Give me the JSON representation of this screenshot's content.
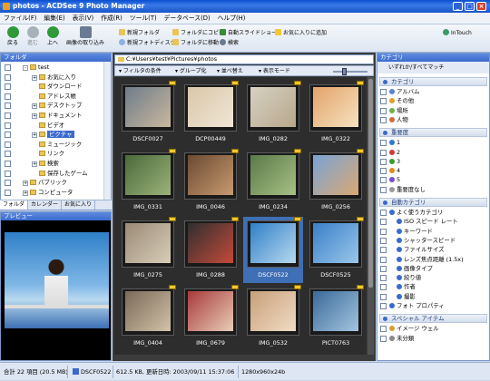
{
  "window": {
    "title": "photos - ACDSee 9 Photo Manager",
    "min": "_",
    "max": "□",
    "close": "×"
  },
  "menu": [
    "ファイル(F)",
    "編集(E)",
    "表示(V)",
    "作成(R)",
    "ツール(T)",
    "データベース(D)",
    "ヘルプ(H)"
  ],
  "toolbar": {
    "back": "戻る",
    "forward": "進む",
    "up": "上へ",
    "acquire": "画像の取り込み",
    "new_folder": "新規フォルダ",
    "new_photo_disc": "新規フォトディスク",
    "copy_to": "フォルダにコピー",
    "move_to": "フォルダに移動",
    "slideshow": "自動スライドショー",
    "search": "検索",
    "add_favorites": "お気に入りに追加",
    "intouch": "InTouch"
  },
  "folder_panel": {
    "title": "フォルダ",
    "items": [
      {
        "label": "test",
        "indent": 1,
        "expander": "-"
      },
      {
        "label": "お気に入り",
        "indent": 2,
        "expander": "+"
      },
      {
        "label": "ダウンロード",
        "indent": 2,
        "expander": ""
      },
      {
        "label": "アドレス帳",
        "indent": 2,
        "expander": ""
      },
      {
        "label": "デスクトップ",
        "indent": 2,
        "expander": "+"
      },
      {
        "label": "ドキュメント",
        "indent": 2,
        "expander": "+"
      },
      {
        "label": "ビデオ",
        "indent": 2,
        "expander": ""
      },
      {
        "label": "ピクチャ",
        "indent": 2,
        "expander": "+",
        "selected": true
      },
      {
        "label": "ミュージック",
        "indent": 2,
        "expander": ""
      },
      {
        "label": "リンク",
        "indent": 2,
        "expander": ""
      },
      {
        "label": "検索",
        "indent": 2,
        "expander": "+"
      },
      {
        "label": "保存したゲーム",
        "indent": 2,
        "expander": ""
      },
      {
        "label": "パブリック",
        "indent": 1,
        "expander": "+"
      },
      {
        "label": "コンピュータ",
        "indent": 1,
        "expander": "+"
      }
    ],
    "tabs": [
      "フォルダ",
      "カレンダー",
      "お気に入り"
    ]
  },
  "preview": {
    "title": "プレビュー"
  },
  "address": "C:¥Users¥test¥Pictures¥photos",
  "filterbar": {
    "filter": "フィルタの条件",
    "group": "グループ化",
    "sort": "並べ替え",
    "view": "表示モード"
  },
  "thumbnails": [
    {
      "name": "DSCF0027",
      "c1": "#6e7c8a",
      "c2": "#c9b89e"
    },
    {
      "name": "DCP00449",
      "c1": "#d9c7a8",
      "c2": "#f0e6d6"
    },
    {
      "name": "IMG_0282",
      "c1": "#d6d1c4",
      "c2": "#b8a78a"
    },
    {
      "name": "IMG_0322",
      "c1": "#e3a36a",
      "c2": "#f6e2c0"
    },
    {
      "name": "IMG_0331",
      "c1": "#4a6a3a",
      "c2": "#9cb27a"
    },
    {
      "name": "IMG_0046",
      "c1": "#6b4a32",
      "c2": "#c79a70"
    },
    {
      "name": "IMG_0234",
      "c1": "#5b7a4a",
      "c2": "#a7c084"
    },
    {
      "name": "IMG_0256",
      "c1": "#7aa4d6",
      "c2": "#d9a872"
    },
    {
      "name": "IMG_0275",
      "c1": "#9a8a76",
      "c2": "#d8cdb8"
    },
    {
      "name": "IMG_0288",
      "c1": "#2f2f2f",
      "c2": "#c44a3a"
    },
    {
      "name": "DSCF0522",
      "c1": "#2f80c8",
      "c2": "#b9d9ef",
      "selected": true
    },
    {
      "name": "DSCF0525",
      "c1": "#3a7fc8",
      "c2": "#9ac7ea"
    },
    {
      "name": "IMG_0404",
      "c1": "#7a6a58",
      "c2": "#d2c2a8"
    },
    {
      "name": "IMG_0679",
      "c1": "#a83a3a",
      "c2": "#e8cdb8"
    },
    {
      "name": "IMG_0532",
      "c1": "#c8a07a",
      "c2": "#f0dcc4"
    },
    {
      "name": "PICT0763",
      "c1": "#3a6a9a",
      "c2": "#a4c4de"
    }
  ],
  "right_panel": {
    "title": "カテゴリ",
    "match": "いずれか/すべてマッチ",
    "sections": {
      "category": "カテゴリ",
      "rating": "重要度",
      "auto": "自動カテゴリ",
      "special": "スペシャル アイテム"
    },
    "categories": [
      "アルバム",
      "その他",
      "場所",
      "人物"
    ],
    "ratings": [
      "1",
      "2",
      "3",
      "4",
      "5",
      "重要度なし"
    ],
    "auto_items": [
      {
        "label": "よく使うカテゴリ",
        "indent": 0
      },
      {
        "label": "ISO スピード レート",
        "indent": 1
      },
      {
        "label": "キーワード",
        "indent": 1
      },
      {
        "label": "シャッタースピード",
        "indent": 1
      },
      {
        "label": "ファイルサイズ",
        "indent": 1
      },
      {
        "label": "レンズ焦点距離 (1.5x)",
        "indent": 1
      },
      {
        "label": "画像タイプ",
        "indent": 1
      },
      {
        "label": "絞り値",
        "indent": 1
      },
      {
        "label": "作者",
        "indent": 1
      },
      {
        "label": "撮影",
        "indent": 1
      },
      {
        "label": "フォト プロパティ",
        "indent": 0
      }
    ],
    "special_items": [
      "イメージ ウェル",
      "未分類"
    ]
  },
  "status": {
    "total": "合計 22 項目 (20.5 MB)",
    "file": "DSCF0522",
    "info": "612.5 KB, 更新日時: 2003/09/11 15:37:06",
    "dims": "1280x960x24b"
  },
  "colors": {
    "accent": "#3b6acc",
    "selected": "#3f6fb5"
  }
}
